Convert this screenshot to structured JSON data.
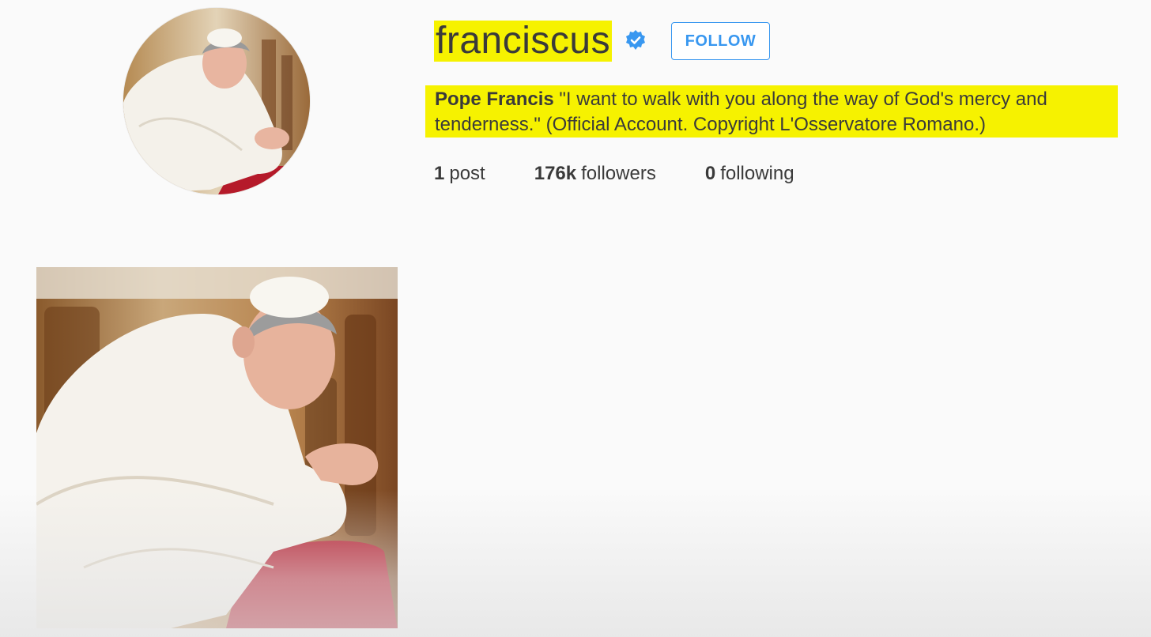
{
  "profile": {
    "username": "franciscus",
    "verified_icon": "verified-badge-icon",
    "follow_label": "FOLLOW",
    "bio_name": "Pope Francis",
    "bio_text": " \"I want to walk with you along the way of God's mercy and tenderness.\" (Official Account. Copyright L'Osservatore Romano.)",
    "avatar_icon": "avatar-photo"
  },
  "stats": {
    "posts": {
      "count": "1",
      "label": "post"
    },
    "followers": {
      "count": "176k",
      "label": "followers"
    },
    "following": {
      "count": "0",
      "label": "following"
    }
  },
  "posts": [
    {
      "icon": "post-photo"
    }
  ],
  "colors": {
    "highlight": "#f6f200",
    "accent_blue": "#3897f0",
    "background": "#fafafa"
  }
}
